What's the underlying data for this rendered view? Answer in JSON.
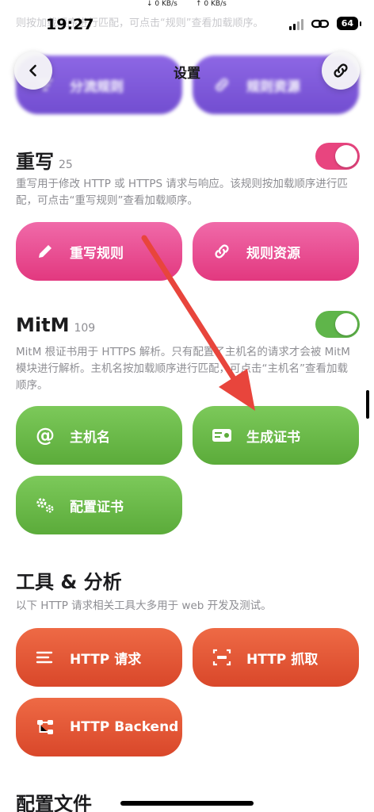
{
  "status": {
    "time": "19:27",
    "net_down": "↓ 0 KB/s",
    "net_up": "↑ 0 KB/s",
    "battery": "64"
  },
  "faded_text": "则按加载顺序进行匹配，可点击“规则”查看加载顺序。",
  "nav": {
    "title": "设置"
  },
  "top_row": {
    "left": "分流规则",
    "right": "规则资源"
  },
  "rewrite": {
    "title": "重写",
    "count": "25",
    "desc": "重写用于修改 HTTP 或 HTTPS 请求与响应。该规则按加载顺序进行匹配，可点击“重写规则”查看加载顺序。",
    "btn_rules": "重写规则",
    "btn_resources": "规则资源",
    "enabled": true,
    "color": "#e8457f"
  },
  "mitm": {
    "title": "MitM",
    "count": "109",
    "desc": "MitM 根证书用于 HTTPS 解析。只有配置了主机名的请求才会被 MitM 模块进行解析。主机名按加载顺序进行匹配，可点击“主机名”查看加载顺序。",
    "btn_hostname": "主机名",
    "btn_gen_cert": "生成证书",
    "btn_config_cert": "配置证书",
    "enabled": true,
    "color": "#5fb54a"
  },
  "tools": {
    "title": "工具 & 分析",
    "desc": "以下 HTTP 请求相关工具大多用于 web 开发及测试。",
    "btn_request": "HTTP 请求",
    "btn_capture": "HTTP 抓取",
    "btn_backend": "HTTP Backend"
  },
  "config": {
    "title": "配置文件"
  }
}
